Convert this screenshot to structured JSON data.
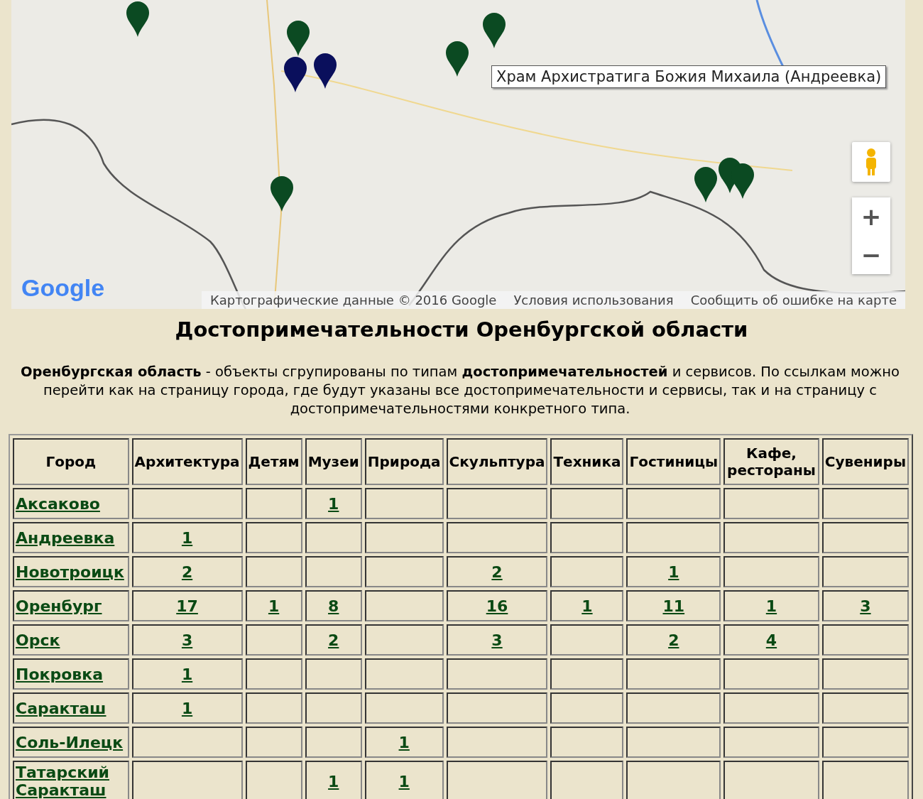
{
  "map": {
    "tooltip": "Храм Архистратига Божия Михаила (Андреевка)",
    "logo": "Google",
    "attribution": [
      "Картографические данные © 2016 Google",
      "Условия использования",
      "Сообщить об ошибке на карте"
    ],
    "zoom_in": "+",
    "zoom_out": "−"
  },
  "title": "Достопримечательности Оренбургской области",
  "intro": "**Оренбургская область** - объекты сгрупированы по типам **достопримечательностей** и сервисов. По ссылкам можно перейти как на страницу города, где будут указаны все достопримечательности и сервисы, так и на страницу с достопримечательностями конкретного типа.",
  "table": {
    "columns": [
      "Город",
      "Архитектура",
      "Детям",
      "Музеи",
      "Природа",
      "Скульптура",
      "Техника",
      "Гостиницы",
      "Кафе, рестораны",
      "Сувениры"
    ],
    "rows": [
      {
        "cells": [
          "Аксаково",
          "",
          "",
          "1",
          "",
          "",
          "",
          "",
          "",
          ""
        ]
      },
      {
        "cells": [
          "Андреевка",
          "1",
          "",
          "",
          "",
          "",
          "",
          "",
          "",
          ""
        ]
      },
      {
        "cells": [
          "Новотроицк",
          "2",
          "",
          "",
          "",
          "2",
          "",
          "1",
          "",
          ""
        ]
      },
      {
        "cells": [
          "Оренбург",
          "17",
          "1",
          "8",
          "",
          "16",
          "1",
          "11",
          "1",
          "3"
        ]
      },
      {
        "cells": [
          "Орск",
          "3",
          "",
          "2",
          "",
          "3",
          "",
          "2",
          "4",
          ""
        ]
      },
      {
        "cells": [
          "Покровка",
          "1",
          "",
          "",
          "",
          "",
          "",
          "",
          "",
          ""
        ]
      },
      {
        "cells": [
          "Саракташ",
          "1",
          "",
          "",
          "",
          "",
          "",
          "",
          "",
          ""
        ]
      },
      {
        "cells": [
          "Соль-Илецк",
          "",
          "",
          "",
          "1",
          "",
          "",
          "",
          "",
          ""
        ]
      },
      {
        "cells": [
          "Татарский Саракташ",
          "",
          "",
          "1",
          "1",
          "",
          "",
          "",
          "",
          ""
        ]
      }
    ]
  }
}
